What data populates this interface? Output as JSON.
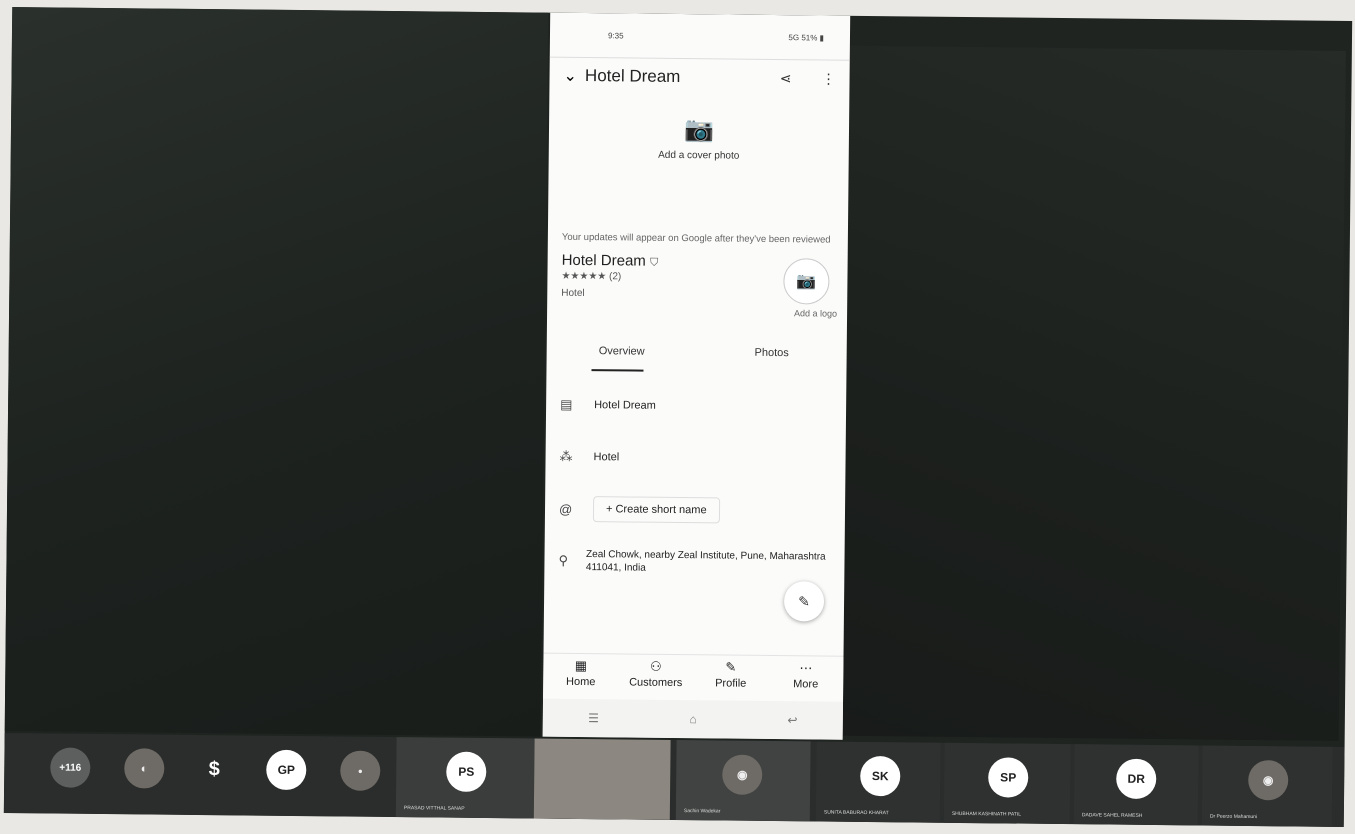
{
  "phone": {
    "statusbar_left": "9:35",
    "statusbar_right": "5G 51% ▮",
    "title": "Hotel Dream",
    "cover_label": "Add a cover photo",
    "notice": "Your updates will appear on Google after they've been reviewed",
    "business_name": "Hotel Dream",
    "rating": "★★★★★ (2)",
    "category": "Hotel",
    "add_logo_label": "Add a logo",
    "tabs": [
      "Overview",
      "Photos"
    ],
    "rows": {
      "name": "Hotel Dream",
      "category": "Hotel",
      "short_name_button": "+ Create short name",
      "address": "Zeal Chowk, nearby Zeal Institute, Pune, Maharashtra 411041, India"
    },
    "bottom_nav": [
      "Home",
      "Customers",
      "Profile",
      "More"
    ]
  },
  "participants": {
    "overflow_count": "+116",
    "avatars": [
      {
        "initials": "GP",
        "color": "#ffffff"
      },
      {
        "initials": "PS",
        "name": "PRASAD VITTHAL SANAP"
      },
      {
        "initials": "SK",
        "name": "SUNITA BABURAO KHARAT"
      },
      {
        "initials": "SP",
        "name": "SHUBHAM KASHINATH PATIL"
      },
      {
        "initials": "DR",
        "name": "DADAVE SAHEL RAMESH"
      }
    ],
    "video_names": [
      "Sachin Wadekar",
      "Dr Peerzo Mahamuni"
    ]
  }
}
